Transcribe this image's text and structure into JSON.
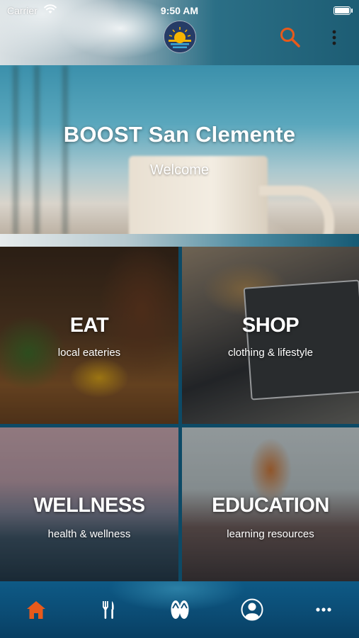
{
  "status_bar": {
    "carrier": "Carrier",
    "time": "9:50 AM"
  },
  "header": {
    "logo_icon": "sunset-logo-icon",
    "search_icon": "search-icon",
    "menu_icon": "more-vertical-icon",
    "accent_color": "#e85a1b"
  },
  "hero": {
    "title": "BOOST San Clemente",
    "subtitle": "Welcome"
  },
  "categories": [
    {
      "title": "EAT",
      "subtitle": "local eateries"
    },
    {
      "title": "SHOP",
      "subtitle": "clothing & lifestyle"
    },
    {
      "title": "WELLNESS",
      "subtitle": "health & wellness"
    },
    {
      "title": "EDUCATION",
      "subtitle": "learning resources"
    }
  ],
  "tab_bar": {
    "active_color": "#e85a1b",
    "inactive_color": "#ffffff",
    "tabs": [
      {
        "icon": "home-icon",
        "active": true
      },
      {
        "icon": "fork-knife-icon",
        "active": false
      },
      {
        "icon": "flip-flops-icon",
        "active": false
      },
      {
        "icon": "profile-icon",
        "active": false
      },
      {
        "icon": "more-horizontal-icon",
        "active": false
      }
    ]
  }
}
